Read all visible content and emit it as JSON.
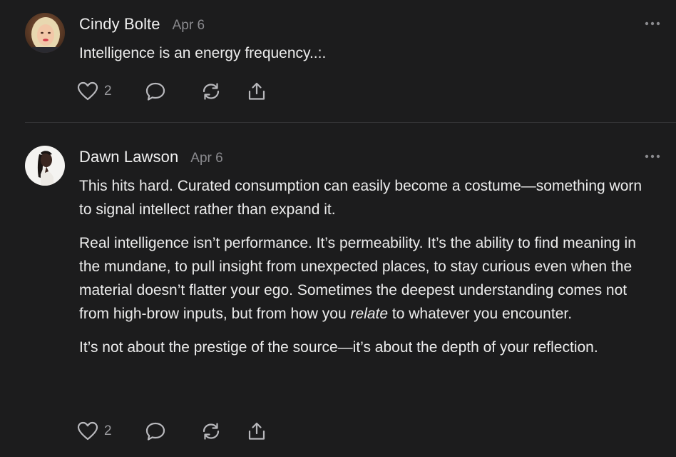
{
  "comments": [
    {
      "author": "Cindy Bolte",
      "date": "Apr 6",
      "avatar": "avatar-blonde-woman",
      "paragraphs": [
        "Intelligence is an energy frequency..:."
      ],
      "likes": "2",
      "icons": [
        "heart-icon",
        "comment-icon",
        "repost-icon",
        "share-icon"
      ]
    },
    {
      "author": "Dawn Lawson",
      "date": "Apr 6",
      "avatar": "avatar-woman-portrait",
      "paragraphs": [
        "This hits hard. Curated consumption can easily become a costume—something worn to signal intellect rather than expand it.",
        "It’s not about the prestige of the source—it’s about the depth of your reflection."
      ],
      "middle_paragraph": {
        "before": "Real intelligence isn’t performance. It’s permeability. It’s the ability to find meaning in the mundane, to pull insight from unexpected places, to stay curious even when the material doesn’t flatter your ego. Sometimes the deepest understanding comes not from high-brow inputs, but from how you ",
        "emphasis": "relate",
        "after": " to whatever you encounter."
      },
      "likes": "2",
      "icons": [
        "heart-icon",
        "comment-icon",
        "repost-icon",
        "share-icon"
      ]
    }
  ],
  "colors": {
    "background": "#1c1c1d",
    "text": "#ececec",
    "muted": "#8a8a8e",
    "divider": "#333335",
    "icon": "#b8b8bc"
  }
}
